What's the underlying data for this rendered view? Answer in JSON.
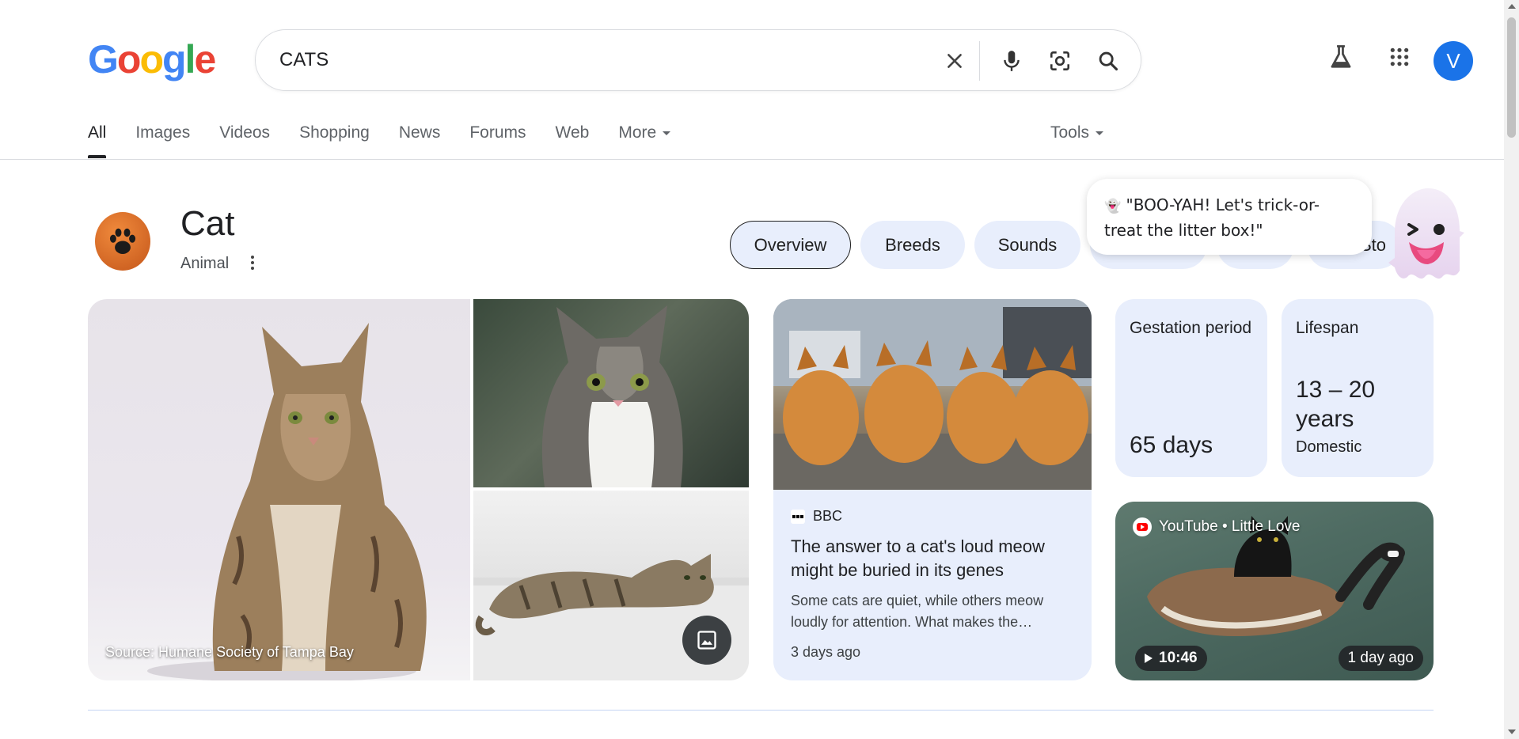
{
  "logo": {
    "text": "Google"
  },
  "search": {
    "query": "CATS"
  },
  "header": {
    "avatar_letter": "V"
  },
  "tabs": [
    {
      "label": "All",
      "active": true
    },
    {
      "label": "Images"
    },
    {
      "label": "Videos"
    },
    {
      "label": "Shopping"
    },
    {
      "label": "News"
    },
    {
      "label": "Forums"
    },
    {
      "label": "Web"
    },
    {
      "label": "More"
    }
  ],
  "tools_label": "Tools",
  "entity": {
    "title": "Cat",
    "subtitle": "Animal"
  },
  "chips": [
    {
      "label": "Overview",
      "active": true
    },
    {
      "label": "Breeds"
    },
    {
      "label": "Sounds"
    },
    {
      "label": "Sto"
    }
  ],
  "bubble": {
    "emoji": "👻",
    "text": "\"BOO-YAH! Let's trick-or-treat the litter box!\""
  },
  "images": {
    "source_caption": "Source: Humane Society of Tampa Bay"
  },
  "news": {
    "source": "BBC",
    "title": "The answer to a cat's loud meow might be buried in its genes",
    "snippet": "Some cats are quiet, while others meow loudly for attention. What makes the…",
    "date": "3 days ago"
  },
  "facts": [
    {
      "label": "Gestation period",
      "value": "65 days",
      "sub": ""
    },
    {
      "label": "Lifespan",
      "value": "13 – 20 years",
      "sub": "Domestic"
    }
  ],
  "video": {
    "source": "YouTube • Little Love",
    "duration": "10:46",
    "age": "1 day ago"
  },
  "colors": {
    "accent": "#1a73e8",
    "card_bg": "#e8eefc"
  }
}
